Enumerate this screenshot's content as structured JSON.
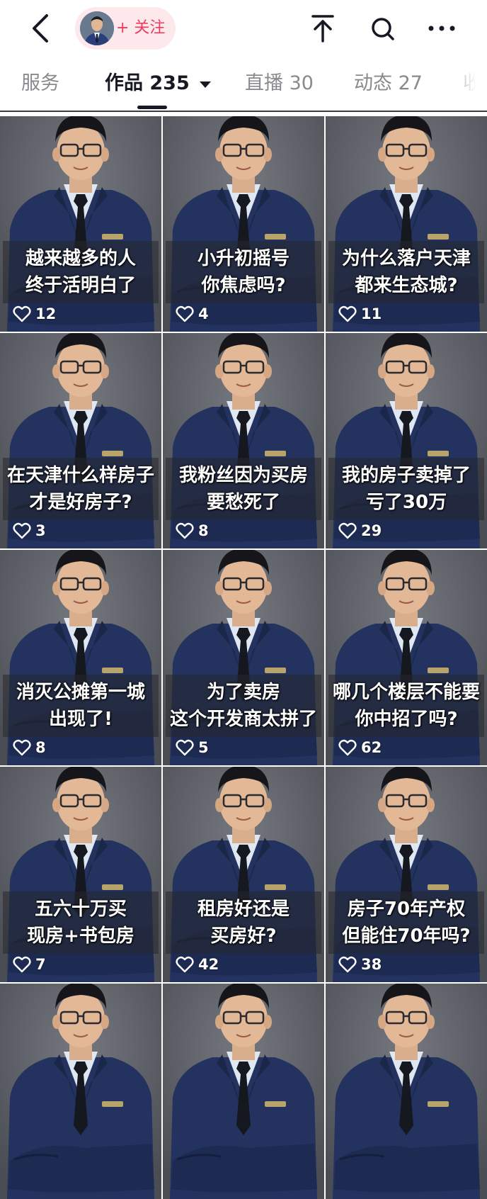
{
  "header": {
    "follow_label": "+ 关注",
    "icons": [
      "back-icon",
      "pin-to-top-icon",
      "search-icon",
      "more-icon"
    ]
  },
  "tabs": [
    {
      "label": "服务",
      "active": false
    },
    {
      "label": "作品 235",
      "active": true
    },
    {
      "label": "直播 30",
      "active": false
    },
    {
      "label": "动态 27",
      "active": false
    },
    {
      "label": "收",
      "active": false
    }
  ],
  "colors": {
    "accent": "#ef3b5d",
    "pill_bg": "#fde8ec",
    "suit": "#1f2f5c",
    "backdrop": "#5e6167"
  },
  "videos": [
    {
      "caption": [
        "越来越多的人",
        "终于活明白了"
      ],
      "likes": "12"
    },
    {
      "caption": [
        "小升初摇号",
        "你焦虑吗?"
      ],
      "likes": "4"
    },
    {
      "caption": [
        "为什么落户天津",
        "都来生态城?"
      ],
      "likes": "11"
    },
    {
      "caption": [
        "在天津什么样房子",
        "才是好房子?"
      ],
      "likes": "3"
    },
    {
      "caption": [
        "我粉丝因为买房",
        "要愁死了"
      ],
      "likes": "8"
    },
    {
      "caption": [
        "我的房子卖掉了",
        "亏了30万"
      ],
      "likes": "29"
    },
    {
      "caption": [
        "消灭公摊第一城",
        "出现了!"
      ],
      "likes": "8"
    },
    {
      "caption": [
        "为了卖房",
        "这个开发商太拼了"
      ],
      "likes": "5"
    },
    {
      "caption": [
        "哪几个楼层不能要",
        "你中招了吗?"
      ],
      "likes": "62"
    },
    {
      "caption": [
        "五六十万买",
        "现房+书包房"
      ],
      "likes": "7"
    },
    {
      "caption": [
        "租房好还是",
        "买房好?"
      ],
      "likes": "42"
    },
    {
      "caption": [
        "房子70年产权",
        "但能住70年吗?"
      ],
      "likes": "38"
    },
    {
      "caption": [],
      "likes": ""
    },
    {
      "caption": [],
      "likes": ""
    },
    {
      "caption": [],
      "likes": ""
    }
  ]
}
